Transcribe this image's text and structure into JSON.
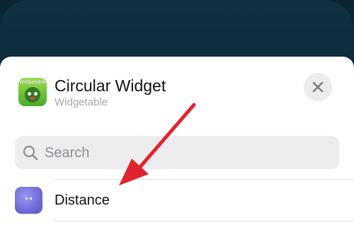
{
  "header": {
    "title": "Circular Widget",
    "subtitle": "Widgetable",
    "app_icon_label": "Widgetable"
  },
  "search": {
    "placeholder": "Search",
    "value": ""
  },
  "widgets": [
    {
      "label": "Distance",
      "icon": "purple-face-icon"
    }
  ],
  "colors": {
    "backdrop": "#0c2533",
    "sheet": "#ffffff",
    "annotation_arrow": "#e0242e",
    "close_button_bg": "#ececef",
    "search_bg": "#ededf0"
  }
}
